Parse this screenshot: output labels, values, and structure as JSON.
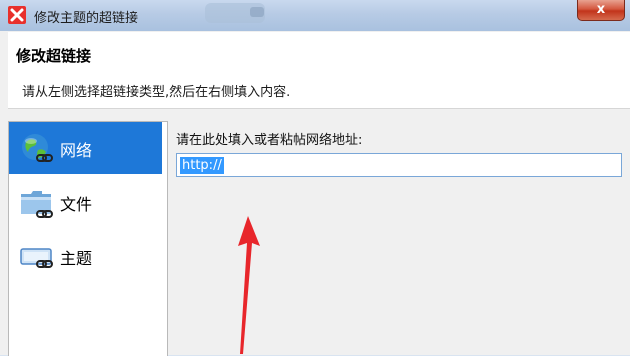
{
  "window": {
    "title": "修改主题的超链接",
    "close_label": "x"
  },
  "header": {
    "title": "修改超链接",
    "subtitle": "请从左侧选择超链接类型,然后在右侧填入内容."
  },
  "sidebar": {
    "items": [
      {
        "label": "网络",
        "icon": "globe-link-icon",
        "selected": true
      },
      {
        "label": "文件",
        "icon": "folder-link-icon",
        "selected": false
      },
      {
        "label": "主题",
        "icon": "topic-link-icon",
        "selected": false
      }
    ]
  },
  "content": {
    "url_label": "请在此处填入或者粘帖网络地址:",
    "url_value": "http://"
  },
  "colors": {
    "selection": "#1e78d8",
    "annotation_arrow": "#e8262b",
    "close_button": "#c2341b"
  }
}
